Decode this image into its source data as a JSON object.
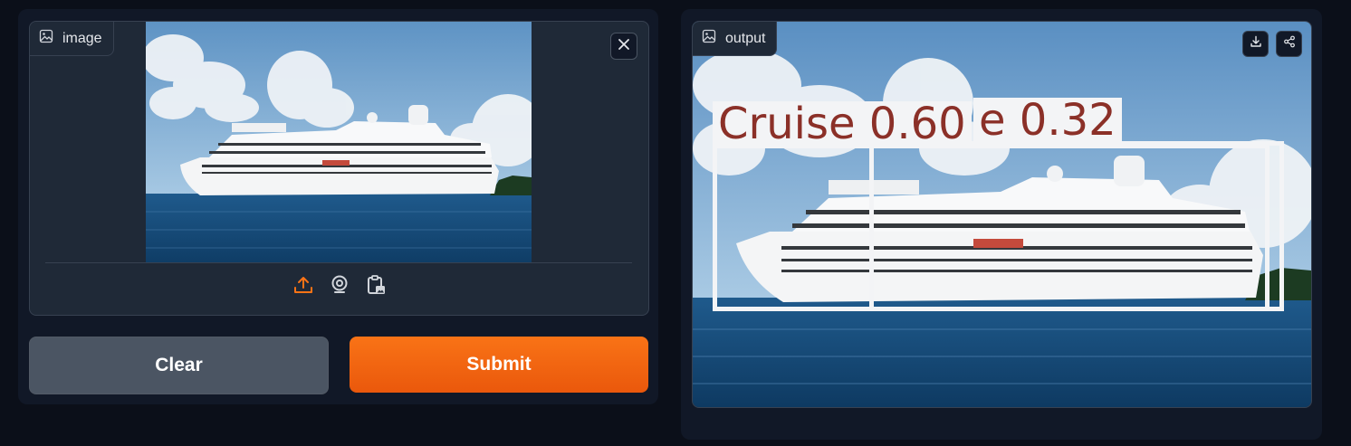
{
  "input": {
    "label": "image",
    "label_icon": "image-icon",
    "close_icon": "close-icon",
    "sources": [
      {
        "icon": "upload-icon",
        "active": true
      },
      {
        "icon": "webcam-icon",
        "active": false
      },
      {
        "icon": "clipboard-icon",
        "active": false
      }
    ]
  },
  "buttons": {
    "clear_label": "Clear",
    "submit_label": "Submit"
  },
  "output": {
    "label": "output",
    "label_icon": "image-icon",
    "download_icon": "download-icon",
    "share_icon": "share-icon",
    "detections": [
      {
        "label": "Cruise 0.60"
      },
      {
        "label": "e 0.32"
      }
    ]
  },
  "colors": {
    "accent": "#f97316",
    "background": "#0b0f19",
    "panel": "#111827",
    "block": "#1f2937",
    "detection_text": "#8b3028"
  }
}
